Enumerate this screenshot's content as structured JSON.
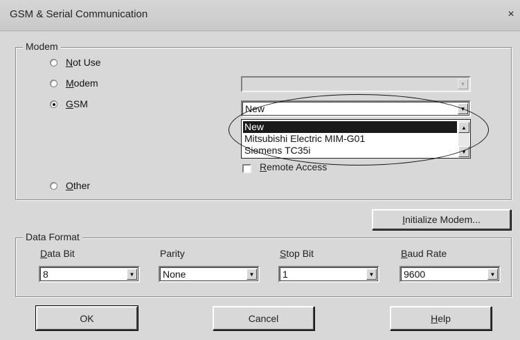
{
  "window": {
    "title": "GSM & Serial Communication",
    "close_glyph": "×"
  },
  "modem_group": {
    "legend": "Modem",
    "options": [
      {
        "label": "Not Use",
        "checked": false
      },
      {
        "label": "Modem",
        "checked": false
      },
      {
        "label": "GSM",
        "checked": true
      },
      {
        "label": "Other",
        "checked": false
      }
    ],
    "modem_combo_value": "",
    "gsm_combo_value": "New",
    "gsm_list": [
      "New",
      "Mitsubishi Electric MIM-G01",
      "Siemens TC35i"
    ],
    "gsm_selected_index": 0,
    "remote_access_label": "Remote Access",
    "remote_access_checked": false
  },
  "initialize_button": "Initialize Modem...",
  "data_format_group": {
    "legend": "Data Format",
    "fields": [
      {
        "label": "Data Bit",
        "value": "8"
      },
      {
        "label": "Parity",
        "value": "None"
      },
      {
        "label": "Stop Bit",
        "value": "1"
      },
      {
        "label": "Baud Rate",
        "value": "9600"
      }
    ]
  },
  "buttons": {
    "ok": "OK",
    "cancel": "Cancel",
    "help": "Help"
  },
  "icons": {
    "dropdown": "chevron-down-icon",
    "scroll_up": "scroll-up-icon",
    "scroll_down": "scroll-down-icon"
  }
}
